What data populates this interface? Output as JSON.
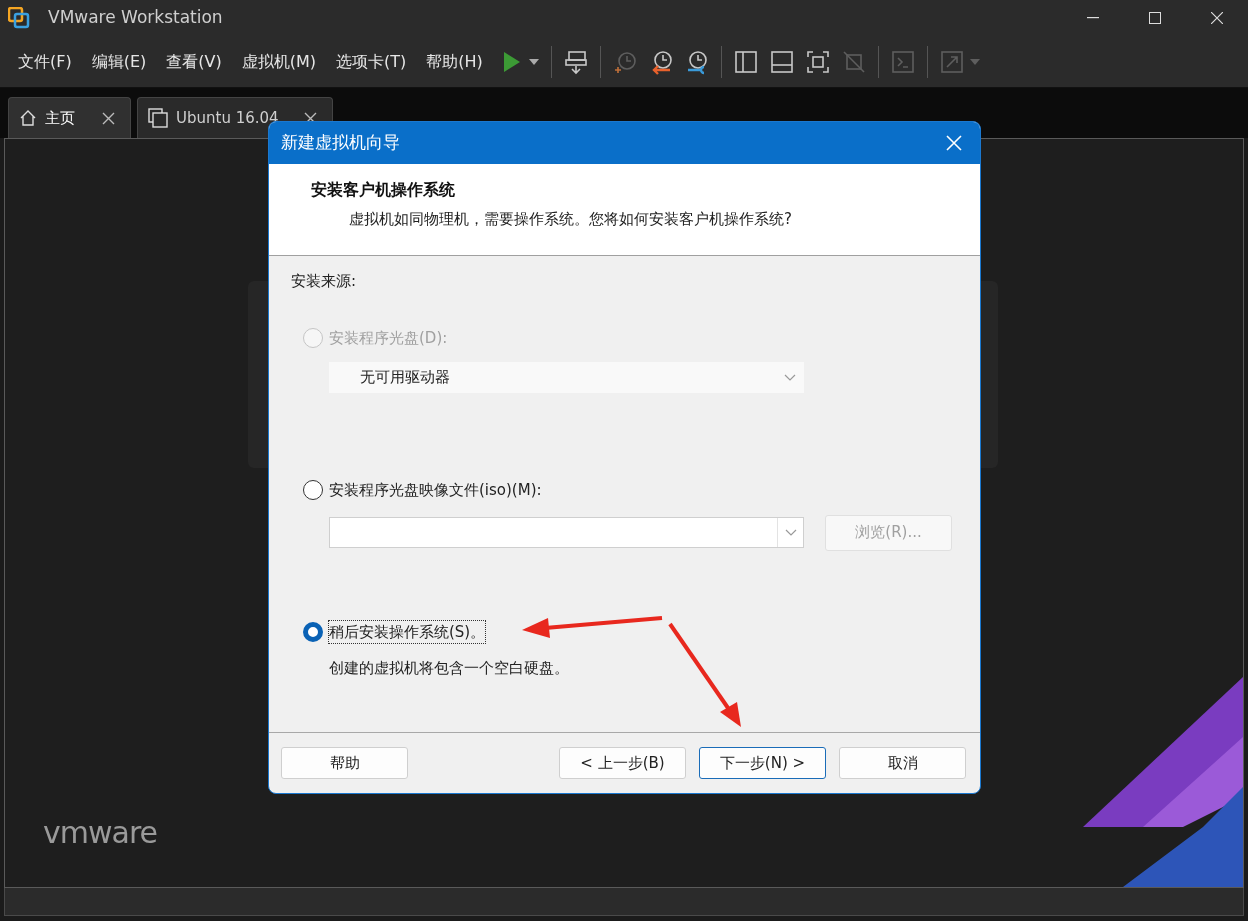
{
  "window": {
    "title": "VMware Workstation"
  },
  "menu": [
    "文件(F)",
    "编辑(E)",
    "查看(V)",
    "虚拟机(M)",
    "选项卡(T)",
    "帮助(H)"
  ],
  "toolbar": [
    {
      "kind": "play",
      "disabled": false,
      "separated": false
    },
    {
      "kind": "send-keys",
      "disabled": false,
      "separated": true
    },
    {
      "kind": "snapshot",
      "disabled": true,
      "separated": true
    },
    {
      "kind": "revert",
      "disabled": false,
      "separated": false
    },
    {
      "kind": "manager",
      "disabled": false,
      "separated": false
    },
    {
      "kind": "library",
      "disabled": false,
      "separated": true
    },
    {
      "kind": "thumbnail",
      "disabled": false,
      "separated": false
    },
    {
      "kind": "fullscreen",
      "disabled": false,
      "separated": false
    },
    {
      "kind": "unity",
      "disabled": true,
      "separated": false
    },
    {
      "kind": "console",
      "disabled": true,
      "separated": true
    },
    {
      "kind": "stretch",
      "disabled": true,
      "separated": true
    }
  ],
  "tabs": [
    {
      "label": "主页",
      "kind": "home",
      "selected": true
    },
    {
      "label": "Ubuntu 16.04",
      "kind": "vm",
      "selected": false
    }
  ],
  "logo": "vmware",
  "dialog": {
    "title": "新建虚拟机向导",
    "heading": "安装客户机操作系统",
    "subheading": "虚拟机如同物理机，需要操作系统。您将如何安装客户机操作系统?",
    "section_label": "安装来源:",
    "options": [
      {
        "kind": "disc",
        "label": "安装程序光盘(D):",
        "selected": false,
        "disabled": true,
        "combo": {
          "value": "无可用驱动器",
          "disabled": true
        }
      },
      {
        "kind": "iso",
        "label": "安装程序光盘映像文件(iso)(M):",
        "selected": false,
        "disabled": false,
        "combo": {
          "disabled": false
        },
        "browse": {
          "label": "浏览(R)...",
          "disabled": true
        }
      },
      {
        "kind": "later",
        "label": "稍后安装操作系统(S)。",
        "selected": true,
        "disabled": false,
        "note": "创建的虚拟机将包含一个空白硬盘。"
      }
    ],
    "buttons": [
      {
        "label": "帮助",
        "default": false
      },
      {
        "label": "< 上一步(B)",
        "default": false
      },
      {
        "label": "下一步(N) >",
        "default": true
      },
      {
        "label": "取消",
        "default": false
      }
    ]
  }
}
